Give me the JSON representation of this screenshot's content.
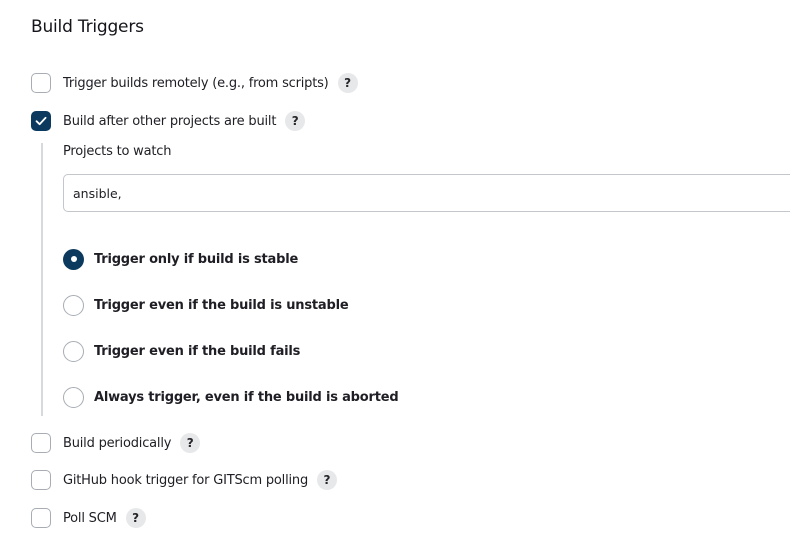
{
  "section": {
    "title": "Build Triggers"
  },
  "triggers": [
    {
      "label": "Trigger builds remotely (e.g., from scripts)",
      "checked": false,
      "help": "?"
    },
    {
      "label": "Build after other projects are built",
      "checked": true,
      "help": "?"
    },
    {
      "label": "Build periodically",
      "checked": false,
      "help": "?"
    },
    {
      "label": "GitHub hook trigger for GITScm polling",
      "checked": false,
      "help": "?"
    },
    {
      "label": "Poll SCM",
      "checked": false,
      "help": "?"
    }
  ],
  "projects_to_watch": {
    "label": "Projects to watch",
    "value": "ansible,"
  },
  "trigger_conditions": {
    "selected_index": 0,
    "options": [
      "Trigger only if build is stable",
      "Trigger even if the build is unstable",
      "Trigger even if the build fails",
      "Always trigger, even if the build is aborted"
    ]
  },
  "colors": {
    "accent": "#0b3a5e",
    "border": "#a8adb4",
    "help_bg": "#e7e8ea"
  },
  "icons": {
    "check": "checkmark-icon",
    "help": "question-mark-icon"
  }
}
